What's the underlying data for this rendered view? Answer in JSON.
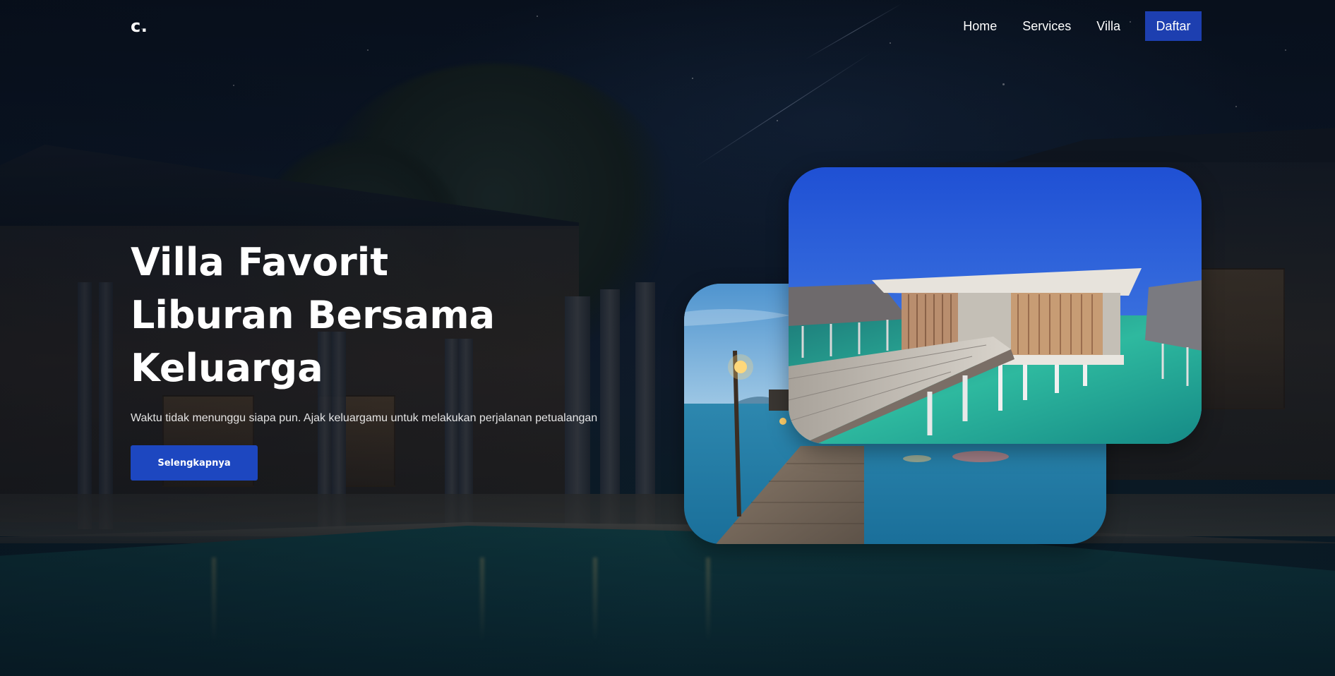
{
  "navbar": {
    "logo": "c.",
    "links": [
      {
        "label": "Home"
      },
      {
        "label": "Services"
      },
      {
        "label": "Villa"
      }
    ],
    "cta_label": "Daftar"
  },
  "hero": {
    "title_lines": [
      "Villa Favorit",
      "Liburan Bersama",
      "Keluarga"
    ],
    "subtitle": "Waktu tidak menunggu siapa pun. Ajak keluargamu untuk melakukan perjalanan petualangan",
    "button_label": "Selengkapnya"
  },
  "images": {
    "back": "water-villa-pier-at-dusk-photo",
    "front": "overwater-bungalow-photo"
  },
  "colors": {
    "accent": "#1d47c0",
    "nav_button": "#1d3fb0",
    "text": "#ffffff"
  }
}
